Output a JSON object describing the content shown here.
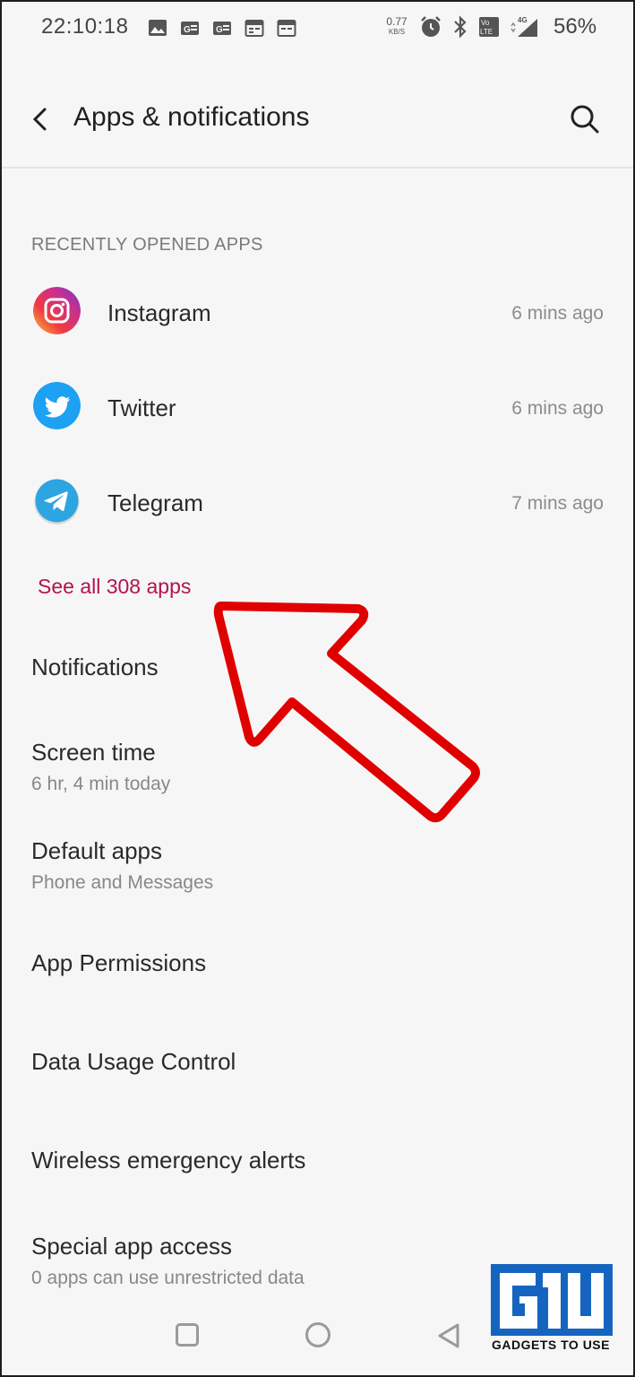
{
  "status_bar": {
    "time": "22:10:18",
    "net_speed": "0.77",
    "net_unit": "KB/S",
    "battery": "56%",
    "notification_icons": [
      "image-icon",
      "google-news-icon",
      "google-news-icon",
      "calendar-icon",
      "calendar-icon"
    ],
    "system_icons": [
      "alarm-icon",
      "bluetooth-icon",
      "volte-icon",
      "signal-4g-icon"
    ]
  },
  "app_bar": {
    "title": "Apps & notifications"
  },
  "recent_apps": {
    "header": "RECENTLY OPENED APPS",
    "items": [
      {
        "name": "Instagram",
        "time": "6 mins ago"
      },
      {
        "name": "Twitter",
        "time": "6 mins ago"
      },
      {
        "name": "Telegram",
        "time": "7 mins ago"
      }
    ],
    "see_all": "See all 308 apps"
  },
  "menu": {
    "notifications": {
      "title": "Notifications"
    },
    "screen_time": {
      "title": "Screen time",
      "subtitle": "6 hr, 4 min today"
    },
    "default_apps": {
      "title": "Default apps",
      "subtitle": "Phone and Messages"
    },
    "app_permissions": {
      "title": "App Permissions"
    },
    "data_usage": {
      "title": "Data Usage Control"
    },
    "emergency_alerts": {
      "title": "Wireless emergency alerts"
    },
    "special_access": {
      "title": "Special app access",
      "subtitle": "0 apps can use unrestricted data"
    }
  },
  "watermark": {
    "text": "GADGETS TO USE"
  },
  "colors": {
    "accent": "#b3134f",
    "background": "#f6f6f6",
    "annotation_arrow": "#e00000"
  }
}
